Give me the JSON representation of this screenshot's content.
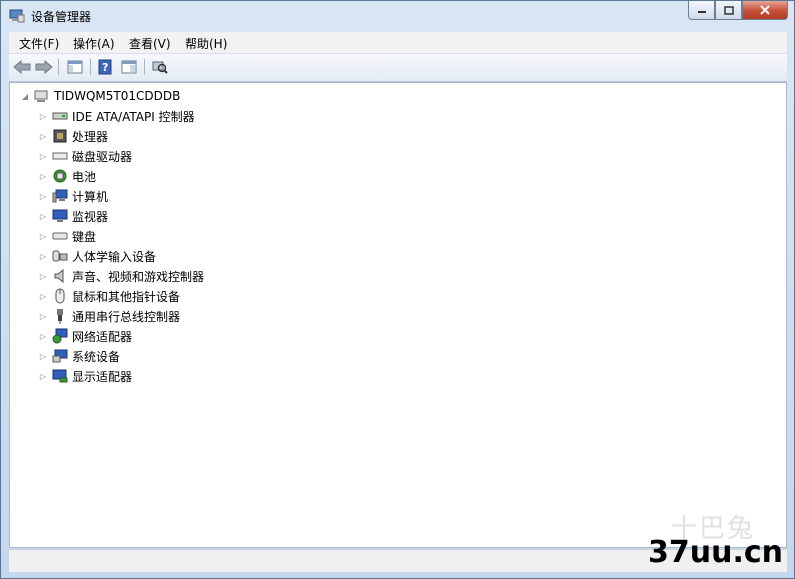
{
  "window": {
    "title": "设备管理器"
  },
  "menu": [
    "文件(F)",
    "操作(A)",
    "查看(V)",
    "帮助(H)"
  ],
  "tree": {
    "root": "TIDWQM5T01CDDDB",
    "categories": [
      "IDE ATA/ATAPI 控制器",
      "处理器",
      "磁盘驱动器",
      "电池",
      "计算机",
      "监视器",
      "键盘",
      "人体学输入设备",
      "声音、视频和游戏控制器",
      "鼠标和其他指针设备",
      "通用串行总线控制器",
      "网络适配器",
      "系统设备",
      "显示适配器"
    ]
  },
  "watermark": {
    "line1": "十巴兔",
    "line2": "37uu.cn"
  }
}
